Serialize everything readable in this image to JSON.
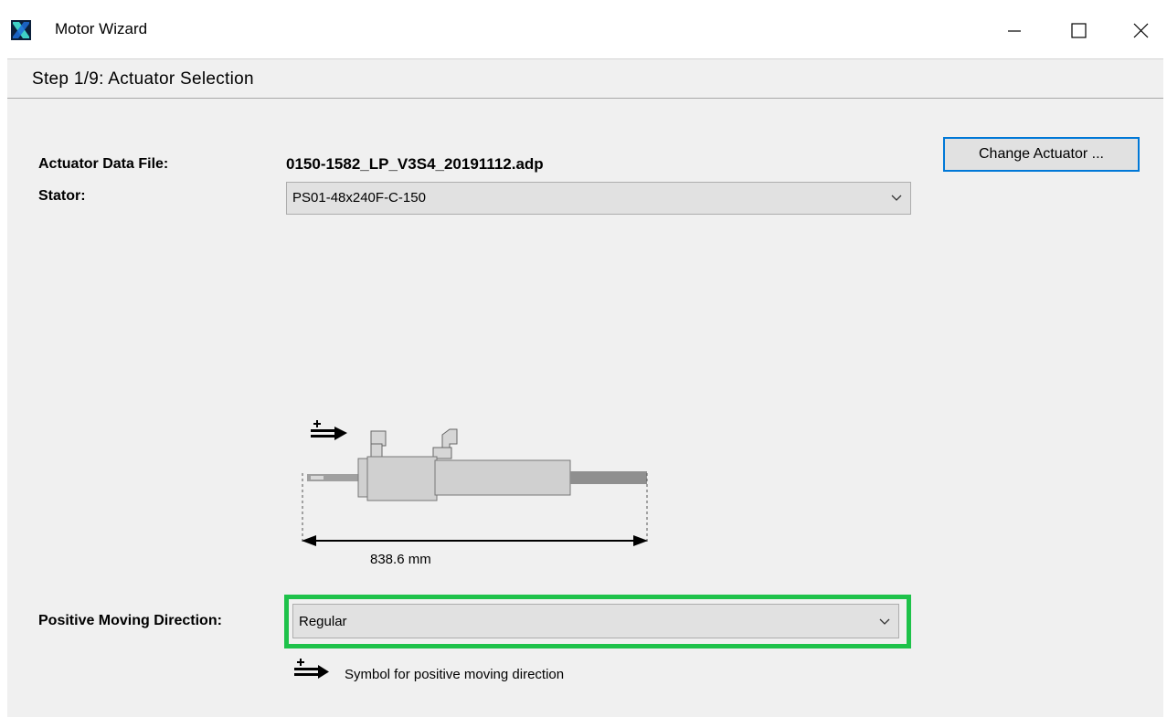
{
  "window": {
    "title": "Motor Wizard"
  },
  "header": {
    "step_title": "Step 1/9: Actuator Selection"
  },
  "form": {
    "actuator_file_label": "Actuator Data File:",
    "actuator_file_value": "0150-1582_LP_V3S4_20191112.adp",
    "change_button_label": "Change Actuator ...",
    "stator_label": "Stator:",
    "stator_value": "PS01-48x240F-C-150",
    "direction_label": "Positive Moving Direction:",
    "direction_value": "Regular"
  },
  "diagram": {
    "dimension_label": "838.6 mm",
    "symbol_caption": "Symbol for positive moving direction"
  },
  "colors": {
    "highlight": "#1ec24a",
    "focus_border": "#0078d7"
  },
  "icons": {
    "app": "motor-wizard-logo-icon",
    "minimize": "minimize-icon",
    "maximize": "maximize-icon",
    "close": "close-icon"
  }
}
